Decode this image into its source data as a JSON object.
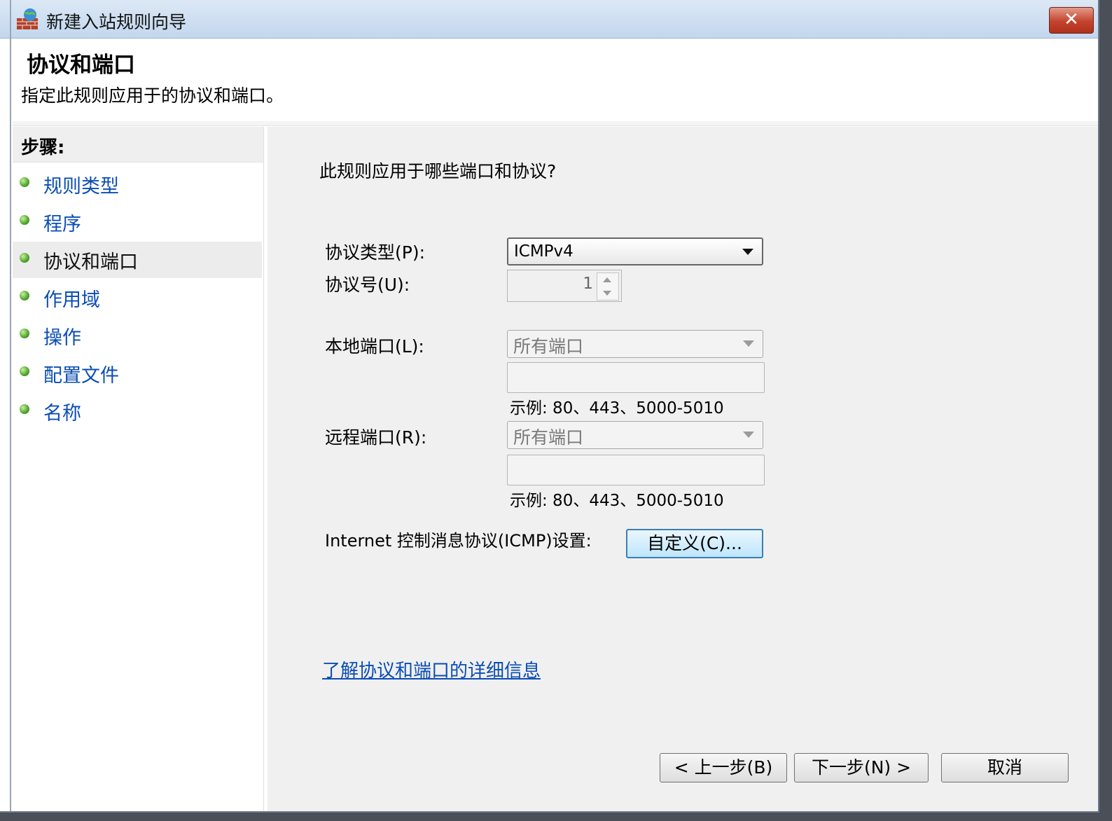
{
  "window": {
    "title": "新建入站规则向导",
    "close_label": "✕"
  },
  "header": {
    "title": "协议和端口",
    "subtitle": "指定此规则应用于的协议和端口。"
  },
  "sidebar": {
    "title": "步骤:",
    "items": [
      {
        "label": "规则类型"
      },
      {
        "label": "程序"
      },
      {
        "label": "协议和端口"
      },
      {
        "label": "作用域"
      },
      {
        "label": "操作"
      },
      {
        "label": "配置文件"
      },
      {
        "label": "名称"
      }
    ]
  },
  "content": {
    "question": "此规则应用于哪些端口和协议?",
    "protocol_type": {
      "label": "协议类型(P):",
      "value": "ICMPv4"
    },
    "protocol_number": {
      "label": "协议号(U):",
      "value": "1"
    },
    "local_port": {
      "label": "本地端口(L):",
      "value": "所有端口",
      "input_value": "",
      "example": "示例: 80、443、5000-5010"
    },
    "remote_port": {
      "label": "远程端口(R):",
      "value": "所有端口",
      "input_value": "",
      "example": "示例: 80、443、5000-5010"
    },
    "icmp": {
      "label": "Internet 控制消息协议(ICMP)设置:",
      "button": "自定义(C)..."
    },
    "learn_more_link": "了解协议和端口的详细信息"
  },
  "footer": {
    "back": "< 上一步(B)",
    "next": "下一步(N) >",
    "cancel": "取消"
  }
}
